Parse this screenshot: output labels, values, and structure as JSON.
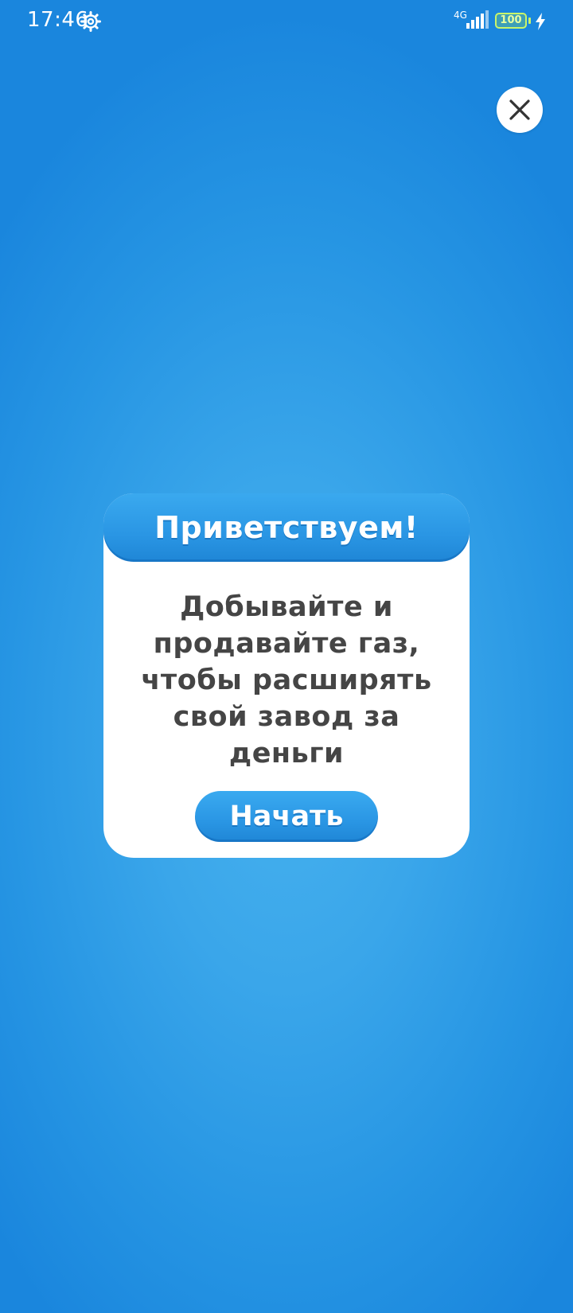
{
  "status_bar": {
    "time": "17:46",
    "network_type": "4G",
    "battery_level": "100",
    "icons": {
      "settings": "gear-icon",
      "signal": "signal-icon",
      "battery": "battery-icon",
      "charging": "bolt-icon"
    }
  },
  "dialog": {
    "title": "Приветствуем!",
    "message": "Добывайте и продавайте газ, чтобы расширять свой завод за деньги",
    "start_button_label": "Начать"
  },
  "close_button": {
    "icon": "close-icon"
  },
  "colors": {
    "background_center": "#47b2ee",
    "background_edge": "#1a86dd",
    "accent_blue": "#2a96e4",
    "dialog_bg": "#ffffff",
    "message_text": "#454545",
    "battery_green": "#c8f56a"
  }
}
